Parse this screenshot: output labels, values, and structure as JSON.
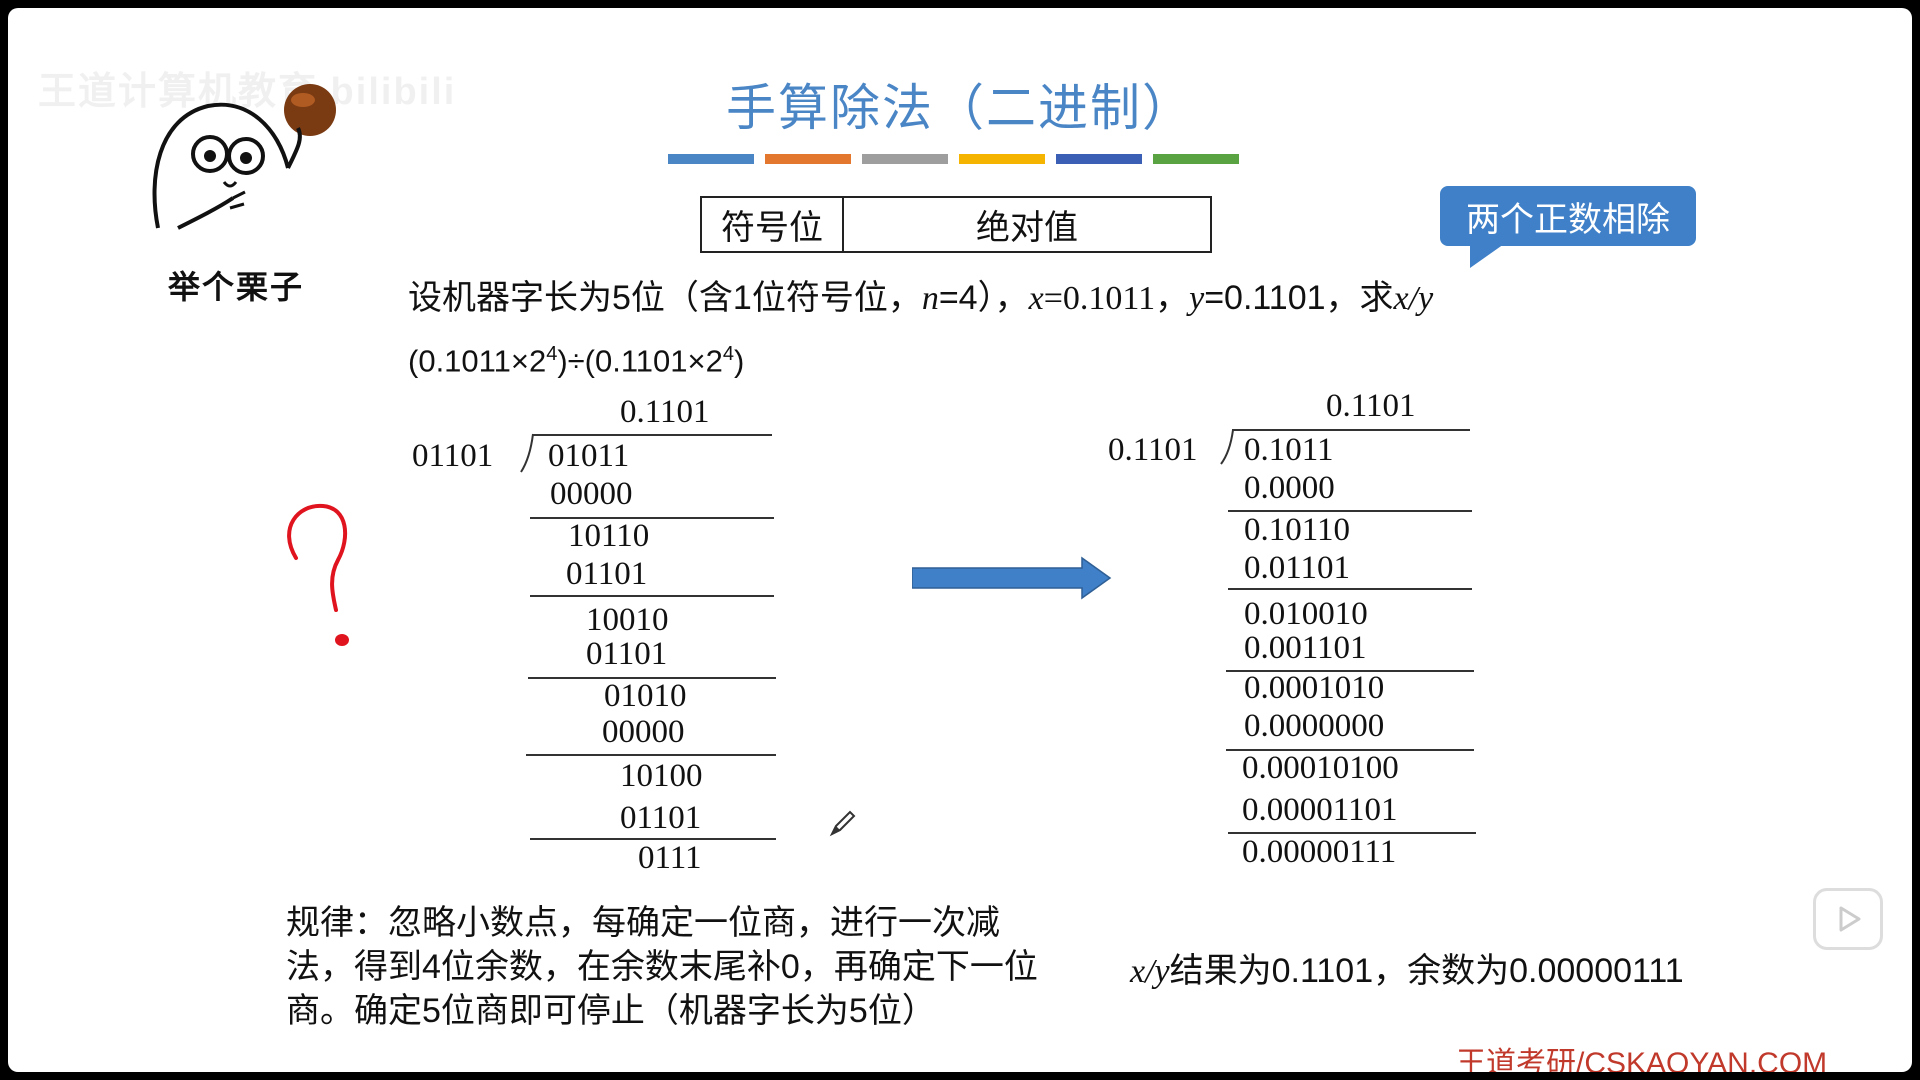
{
  "watermark": "王道计算机教育 bilibili",
  "meme_label": "举个栗子",
  "title": "手算除法（二进制）",
  "colorbar": [
    "#4a86c6",
    "#e4772e",
    "#9e9e9e",
    "#f4b400",
    "#3b5fb5",
    "#5aa342"
  ],
  "sign_table": {
    "sign": "符号位",
    "abs": "绝对值"
  },
  "callout": "两个正数相除",
  "problem": {
    "p1": "设机器字长为5位（含1位符号位，",
    "n": "n",
    "p2": "=4），",
    "x": "x",
    "p3": "=0.1011，",
    "y": "y",
    "p4": "=0.1101，求",
    "xy": "x/y"
  },
  "expression": {
    "a": "(0.1011×2",
    "e1": "4",
    "b": ")÷(0.1101×2",
    "e2": "4",
    "c": ")"
  },
  "left_division": {
    "quotient": "0.1101",
    "divisor": "01101",
    "rows": [
      "01011",
      "00000",
      "10110",
      "01101",
      "10010",
      "01101",
      "01010",
      "00000",
      "10100",
      "01101",
      "0111"
    ]
  },
  "right_division": {
    "quotient": "0.1101",
    "divisor": "0.1101",
    "rows": [
      "0.1011",
      "0.0000",
      "0.10110",
      "0.01101",
      "0.010010",
      "0.001101",
      "0.0001010",
      "0.0000000",
      "0.00010100",
      "0.00001101",
      "0.00000111"
    ]
  },
  "rule": "规律：忽略小数点，每确定一位商，进行一次减法，得到4位余数，在余数末尾补0，再确定下一位商。确定5位商即可停止（机器字长为5位）",
  "result": {
    "xy": "x/y",
    "text": "结果为0.1101，余数为0.00000111"
  },
  "brand": "王道考研/CSKAOYAN.COM",
  "colors": {
    "title": "#4a86c6",
    "callout": "#3f80c8",
    "arrow": "#3f80c8",
    "annotation": "#e0141e",
    "brand": "#c0392b"
  }
}
